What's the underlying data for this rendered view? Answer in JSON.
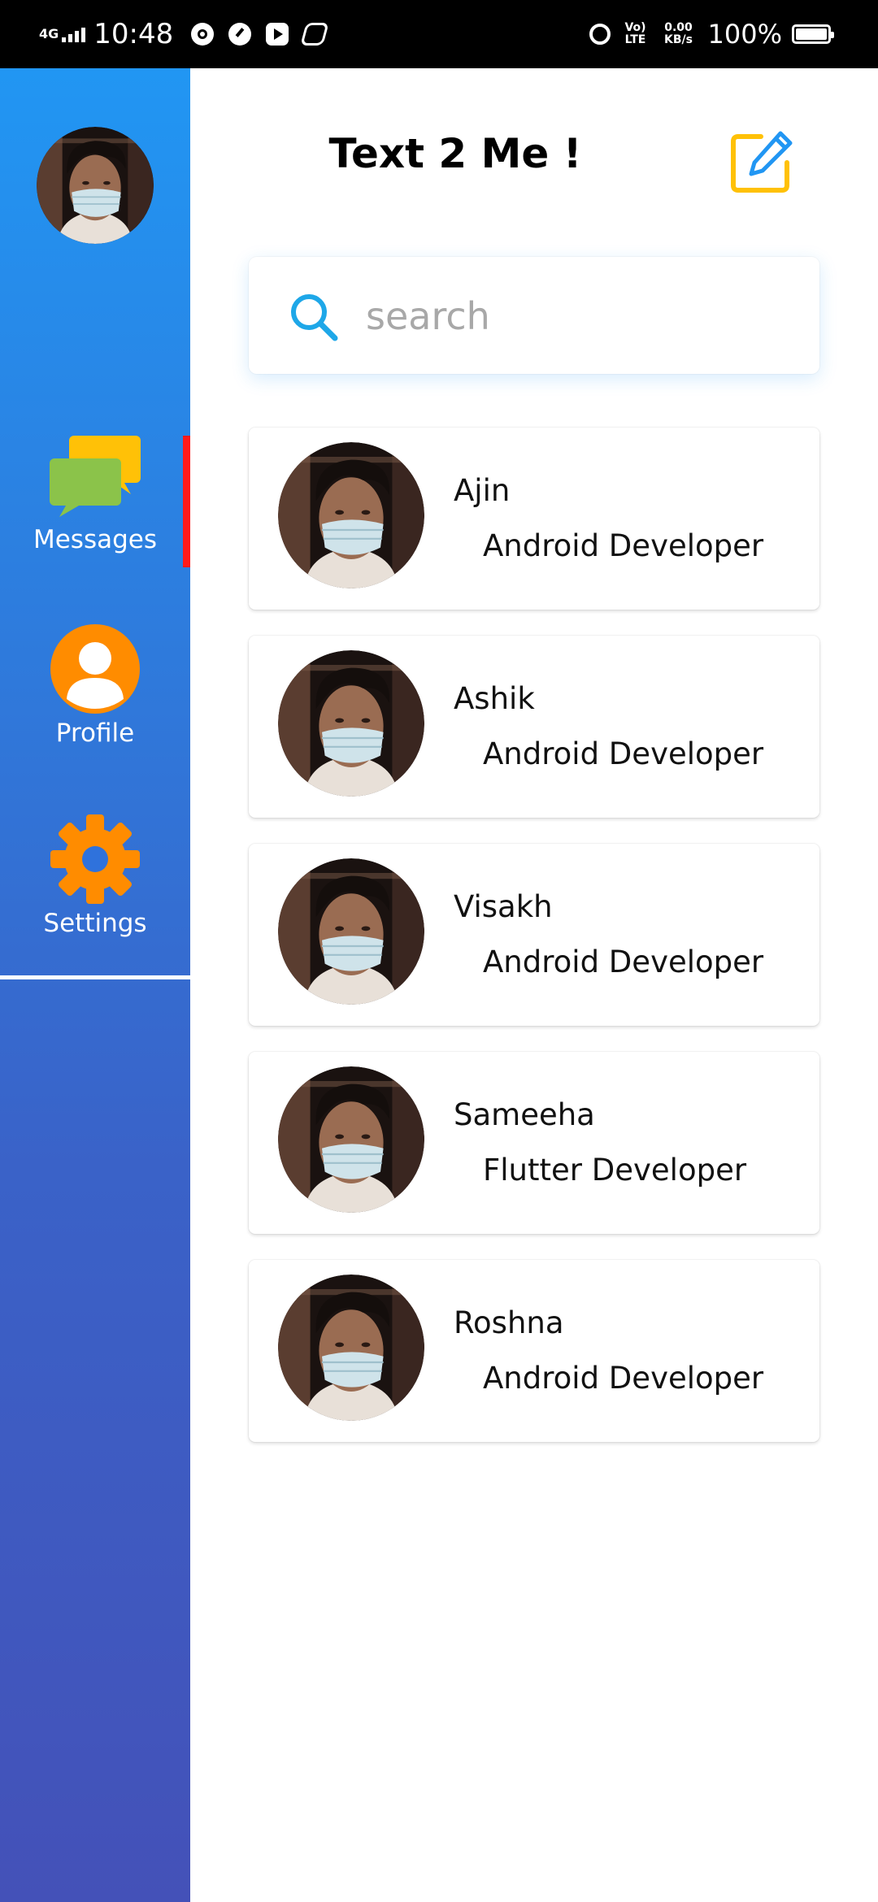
{
  "status_bar": {
    "network": "4G",
    "time": "10:48",
    "volte": "Vo) LTE",
    "speed": "0.00 KB/s",
    "battery": "100%",
    "icons": [
      "whatsapp-icon",
      "speedometer-icon",
      "youtube-icon",
      "app-icon",
      "alarm-icon"
    ]
  },
  "sidebar": {
    "nav": [
      {
        "label": "Messages",
        "icon": "chat-bubbles-icon",
        "active": true
      },
      {
        "label": "Profile",
        "icon": "user-circle-icon",
        "active": false
      },
      {
        "label": "Settings",
        "icon": "gear-icon",
        "active": false
      }
    ],
    "colors": {
      "gradient_top": "#2196f3",
      "gradient_bottom": "#4451b8",
      "active_indicator": "#ff1a1a",
      "icon_orange": "#ff8c00"
    }
  },
  "header": {
    "title": "Text 2 Me !",
    "compose_icon": "edit-icon"
  },
  "search": {
    "placeholder": "search",
    "icon": "search-icon"
  },
  "contacts": [
    {
      "name": "Ajin",
      "role": "Android Developer"
    },
    {
      "name": "Ashik",
      "role": "Android Developer"
    },
    {
      "name": "Visakh",
      "role": "Android Developer"
    },
    {
      "name": "Sameeha",
      "role": "Flutter Developer"
    },
    {
      "name": "Roshna",
      "role": "Android Developer"
    }
  ]
}
